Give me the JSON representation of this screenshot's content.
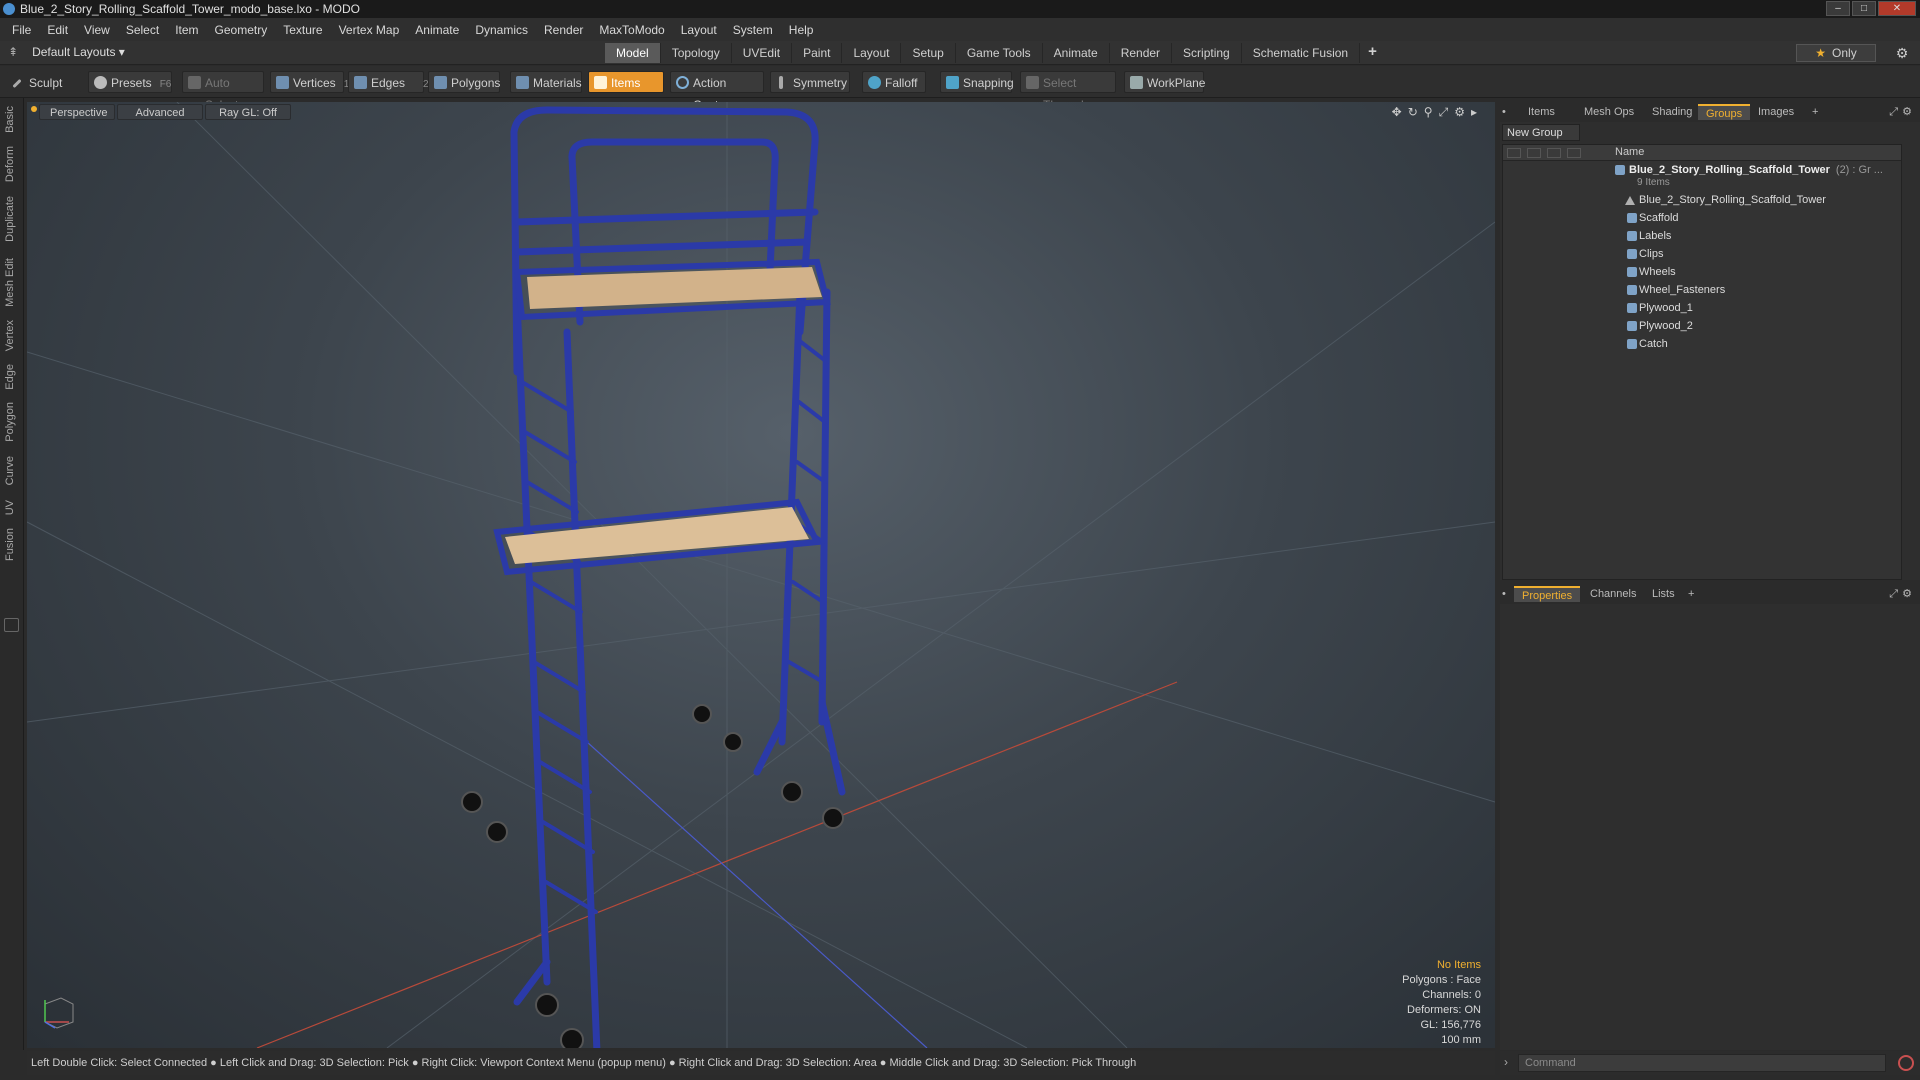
{
  "window": {
    "title": "Blue_2_Story_Rolling_Scaffold_Tower_modo_base.lxo - MODO"
  },
  "menu": [
    "File",
    "Edit",
    "View",
    "Select",
    "Item",
    "Geometry",
    "Texture",
    "Vertex Map",
    "Animate",
    "Dynamics",
    "Render",
    "MaxToModo",
    "Layout",
    "System",
    "Help"
  ],
  "layout": {
    "selector": "Default Layouts",
    "tabs": [
      "Model",
      "Topology",
      "UVEdit",
      "Paint",
      "Layout",
      "Setup",
      "Game Tools",
      "Animate",
      "Render",
      "Scripting",
      "Schematic Fusion"
    ],
    "active_tab": "Model",
    "only_label": "Only"
  },
  "toolbar": {
    "sculpt": "Sculpt",
    "presets": "Presets",
    "presets_hotkey": "F6",
    "auto_select": "Auto Select",
    "vertices": "Vertices",
    "vertices_count": "1",
    "edges": "Edges",
    "edges_count": "2",
    "polygons": "Polygons",
    "materials": "Materials",
    "items": "Items",
    "action_center": "Action Center",
    "symmetry": "Symmetry",
    "falloff": "Falloff",
    "snapping": "Snapping",
    "select_through": "Select Through",
    "workplane": "WorkPlane"
  },
  "left_tabs": [
    "Basic",
    "Deform",
    "Duplicate",
    "Mesh Edit",
    "Vertex",
    "Edge",
    "Polygon",
    "Curve",
    "UV",
    "Fusion"
  ],
  "viewport": {
    "view": "Perspective",
    "shading": "Advanced",
    "raygl": "Ray GL: Off",
    "info": {
      "selection": "No Items",
      "polygons": "Polygons : Face",
      "channels": "Channels: 0",
      "deformers": "Deformers: ON",
      "gl": "GL: 156,776",
      "scale": "100 mm"
    }
  },
  "status": "Left Double Click: Select Connected ● Left Click and Drag: 3D Selection: Pick ● Right Click: Viewport Context Menu (popup menu) ● Right Click and Drag: 3D Selection: Area ● Middle Click and Drag: 3D Selection: Pick Through",
  "right_panel": {
    "tabs": [
      "Items",
      "Mesh Ops",
      "Shading",
      "Groups",
      "Images"
    ],
    "active_tab": "Groups",
    "new_group": "New Group",
    "column_name": "Name",
    "group": {
      "name": "Blue_2_Story_Rolling_Scaffold_Tower",
      "count": "(2) : Gr ...",
      "sub": "9 Items"
    },
    "items": [
      "Blue_2_Story_Rolling_Scaffold_Tower",
      "Scaffold",
      "Labels",
      "Clips",
      "Wheels",
      "Wheel_Fasteners",
      "Plywood_1",
      "Plywood_2",
      "Catch"
    ]
  },
  "props_panel": {
    "tabs": [
      "Properties",
      "Channels",
      "Lists"
    ],
    "active_tab": "Properties"
  },
  "command": {
    "placeholder": "Command"
  },
  "colors": {
    "accent": "#e8962c",
    "scaffold": "#2b3aa8",
    "plywood": "#d8b890"
  }
}
